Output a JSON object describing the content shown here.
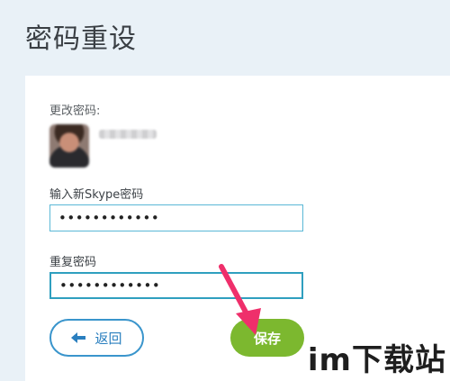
{
  "page": {
    "title": "密码重设"
  },
  "form": {
    "section_label": "更改密码:",
    "new_password_label": "输入新Skype密码",
    "new_password_value": "••••••••••••",
    "confirm_password_label": "重复密码",
    "confirm_password_value": "••••••••••••"
  },
  "actions": {
    "back_label": "返回",
    "save_label": "保存"
  },
  "watermark": {
    "text": "im下载站"
  },
  "colors": {
    "accent_blue": "#3a95cc",
    "save_green": "#7cb82f",
    "pointer_pink": "#ef2f6b",
    "background": "#e9f1f7"
  },
  "icons": {
    "back": "arrow-left-icon",
    "pointer": "pointer-arrow-icon"
  }
}
